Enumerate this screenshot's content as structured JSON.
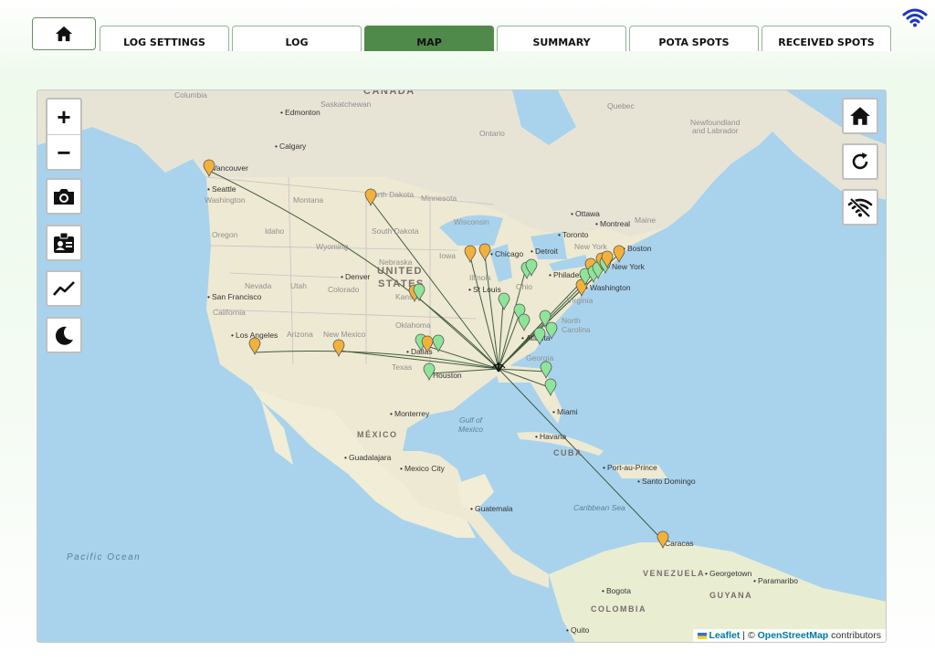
{
  "tabs": {
    "home_icon": "home-icon",
    "items": [
      {
        "label": "LOG SETTINGS",
        "active": false
      },
      {
        "label": "LOG",
        "active": false
      },
      {
        "label": "MAP",
        "active": true
      },
      {
        "label": "SUMMARY",
        "active": false
      },
      {
        "label": "POTA SPOTS",
        "active": false
      },
      {
        "label": "RECEIVED SPOTS",
        "active": false
      }
    ]
  },
  "status": {
    "wifi_icon": "wifi-icon",
    "wifi_color": "#1a35c4"
  },
  "map": {
    "controls_left": {
      "zoom_in": "+",
      "zoom_out": "−",
      "icons": [
        "camera-icon",
        "id-card-icon",
        "chart-line-icon",
        "moon-icon"
      ]
    },
    "controls_right": {
      "icons": [
        "home-icon",
        "refresh-icon",
        "wifi-off-icon"
      ]
    },
    "labels": {
      "countries": [
        "CANADA",
        "UNITED",
        "STATES",
        "MÉXICO",
        "CUBA",
        "VENEZUELA",
        "COLOMBIA",
        "GUYANA"
      ],
      "water": [
        "Gulf of",
        "Mexico",
        "Caribbean Sea",
        "Pacific Ocean"
      ],
      "states": [
        "Columbia",
        "Saskatchewan",
        "Newfoundland",
        "and Labrador",
        "Quebec",
        "Ontario",
        "Washington",
        "Montana",
        "North Dakota",
        "Minnesota",
        "Wisconsin",
        "South Dakota",
        "Oregon",
        "Idaho",
        "Wyoming",
        "Nebraska",
        "Iowa",
        "Nevada",
        "Utah",
        "Colorado",
        "Kansas",
        "Illinois",
        "California",
        "Arizona",
        "New Mexico",
        "Oklahoma",
        "Texas",
        "Georgia",
        "North",
        "Carolina",
        "Virginia",
        "New York",
        "Maine",
        "Ohio"
      ],
      "cities": [
        "Edmonton",
        "Calgary",
        "Vancouver",
        "Seattle",
        "Denver",
        "San Francisco",
        "Los Angeles",
        "Chicago",
        "Detroit",
        "St Louis",
        "Toronto",
        "Ottawa",
        "Montreal",
        "Boston",
        "New York",
        "Philadelphia",
        "Washington",
        "Houston",
        "Dallas",
        "Atlanta",
        "Miami",
        "Havana",
        "Monterrey",
        "Guadalajara",
        "Mexico City",
        "Guatemala",
        "Port-au-Prince",
        "Santo Domingo",
        "Caracas",
        "Georgetown",
        "Paramaribo",
        "Bogota",
        "Quito"
      ]
    },
    "colors": {
      "marker_orange": "#f2b23a",
      "marker_green": "#8ee59a",
      "path": "#2f4f2f"
    },
    "attribution": {
      "leaflet": "Leaflet",
      "separator": "|",
      "copyright": "©",
      "osm": "OpenStreetMap",
      "suffix": "contributors"
    }
  }
}
